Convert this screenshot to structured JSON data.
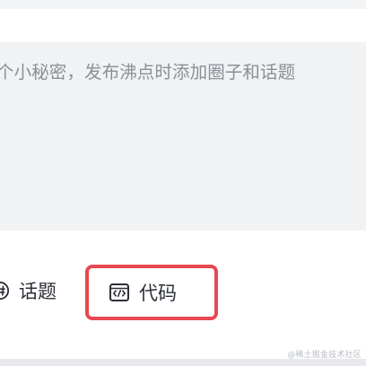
{
  "editor": {
    "placeholder": "个小秘密，发布沸点时添加圈子和话题"
  },
  "toolbar": {
    "topic_label": "话题",
    "code_label": "代码"
  },
  "watermark": "@稀土掘金技术社区",
  "colors": {
    "highlight": "#e8484f",
    "text": "#2b2f36",
    "placeholder": "#8b8f97",
    "editor_bg": "#f1f2f4"
  },
  "icons": {
    "topic": "hash-circle-icon",
    "code": "code-box-icon"
  }
}
